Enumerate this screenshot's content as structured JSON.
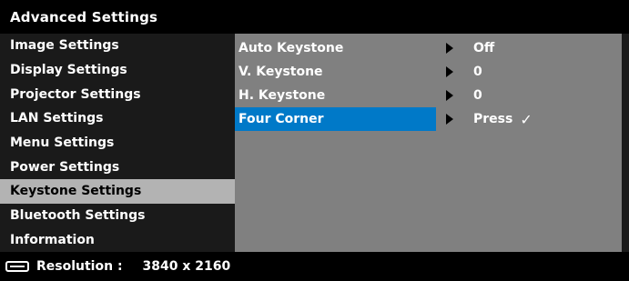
{
  "title": "Advanced Settings",
  "sidebar": {
    "items": [
      {
        "label": "Image Settings",
        "selected": false
      },
      {
        "label": "Display Settings",
        "selected": false
      },
      {
        "label": "Projector Settings",
        "selected": false
      },
      {
        "label": "LAN Settings",
        "selected": false
      },
      {
        "label": "Menu Settings",
        "selected": false
      },
      {
        "label": "Power Settings",
        "selected": false
      },
      {
        "label": "Keystone Settings",
        "selected": true
      },
      {
        "label": "Bluetooth Settings",
        "selected": false
      },
      {
        "label": "Information",
        "selected": false
      }
    ]
  },
  "panel": {
    "rows": [
      {
        "label": "Auto Keystone",
        "value": "Off"
      },
      {
        "label": "V. Keystone",
        "value": "0"
      },
      {
        "label": "H. Keystone",
        "value": "0"
      },
      {
        "label": "Four Corner",
        "value": "Press",
        "check": "✓",
        "highlighted": true
      }
    ]
  },
  "status": {
    "icon": "input-port-icon",
    "label": "Resolution :",
    "value": "3840 x 2160"
  },
  "colors": {
    "background": "#000000",
    "panel": "#808080",
    "selected_nav": "#b3b3b3",
    "highlight": "#0079c8"
  }
}
